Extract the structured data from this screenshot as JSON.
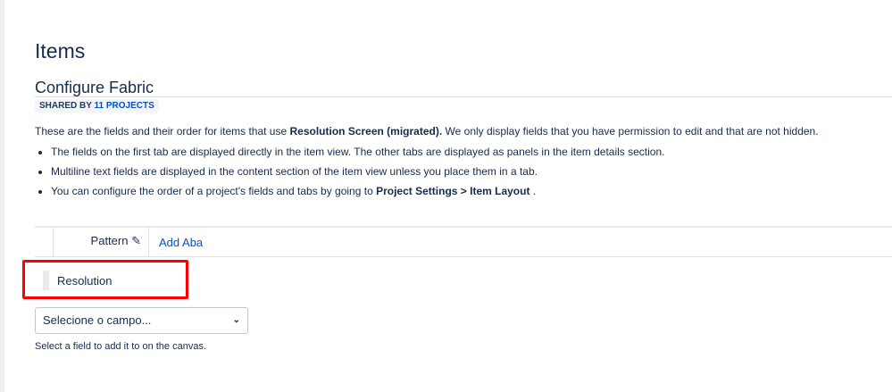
{
  "page_title": "Items",
  "screen_name": "Configure Fabric",
  "badge": {
    "prefix": "SHARED BY",
    "link": "11 PROJECTS"
  },
  "intro": {
    "before": "These are the fields and their order for items that use ",
    "bold": "Resolution Screen (migrated).",
    "after": " We only display fields that you have permission to edit and that are not hidden."
  },
  "bullets": {
    "b1": "The fields on the first tab are displayed directly in the item view. The other tabs are displayed as panels in the item details section.",
    "b2": "Multiline text fields are displayed in the content section of the item view unless you place them in a tab.",
    "b3_before": "You can configure the order of a project's fields and tabs by going to ",
    "b3_bold": "Project Settings > Item Layout",
    "b3_after": " ."
  },
  "tabs": {
    "active": "Pattern",
    "add": "Add Aba"
  },
  "fields": [
    "Resolution"
  ],
  "select": {
    "placeholder": "Selecione o campo...",
    "help": "Select a field to add it to on the canvas."
  }
}
